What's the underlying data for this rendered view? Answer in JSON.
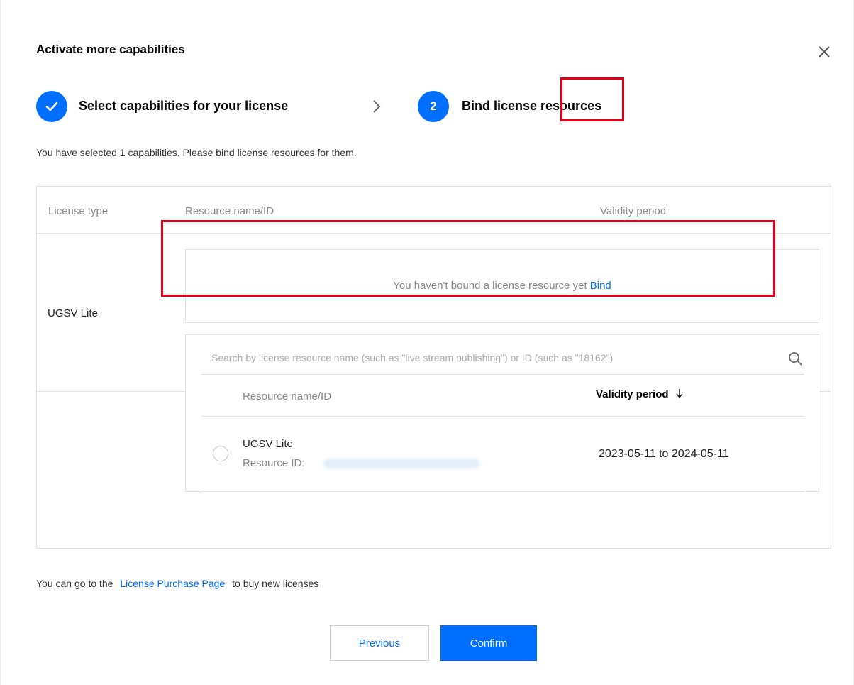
{
  "dialog": {
    "title": "Activate more capabilities",
    "steps": [
      {
        "number": "",
        "label": "Select capabilities for your license",
        "state": "done"
      },
      {
        "number": "2",
        "label": "Bind license resources",
        "state": "active"
      }
    ],
    "intro": "You have selected 1 capabilities. Please bind license resources for them."
  },
  "table": {
    "headers": {
      "license_type": "License type",
      "resource": "Resource name/ID",
      "validity": "Validity period"
    },
    "row": {
      "license_type": "UGSV Lite",
      "bind_prompt": "You haven't bound a license resource yet",
      "bind_link": "Bind"
    }
  },
  "dropdown": {
    "search_placeholder": "Search by license resource name (such as \"live stream publishing\") or ID (such as \"18162\")",
    "headers": {
      "resource": "Resource name/ID",
      "validity": "Validity period"
    },
    "items": [
      {
        "name": "UGSV Lite",
        "id_label": "Resource ID:",
        "validity": "2023-05-11 to 2024-05-11"
      }
    ]
  },
  "footer": {
    "purchase_prefix": "You can go to the",
    "purchase_link": "License Purchase Page",
    "purchase_suffix": "to buy new licenses",
    "previous": "Previous",
    "confirm": "Confirm"
  },
  "colors": {
    "primary": "#006eff",
    "highlight": "#e0001a"
  },
  "icons": {
    "close": "close-icon",
    "check": "check-icon",
    "step_arrow": "chevron-right-icon",
    "search": "search-icon",
    "sort": "arrow-down-icon"
  }
}
